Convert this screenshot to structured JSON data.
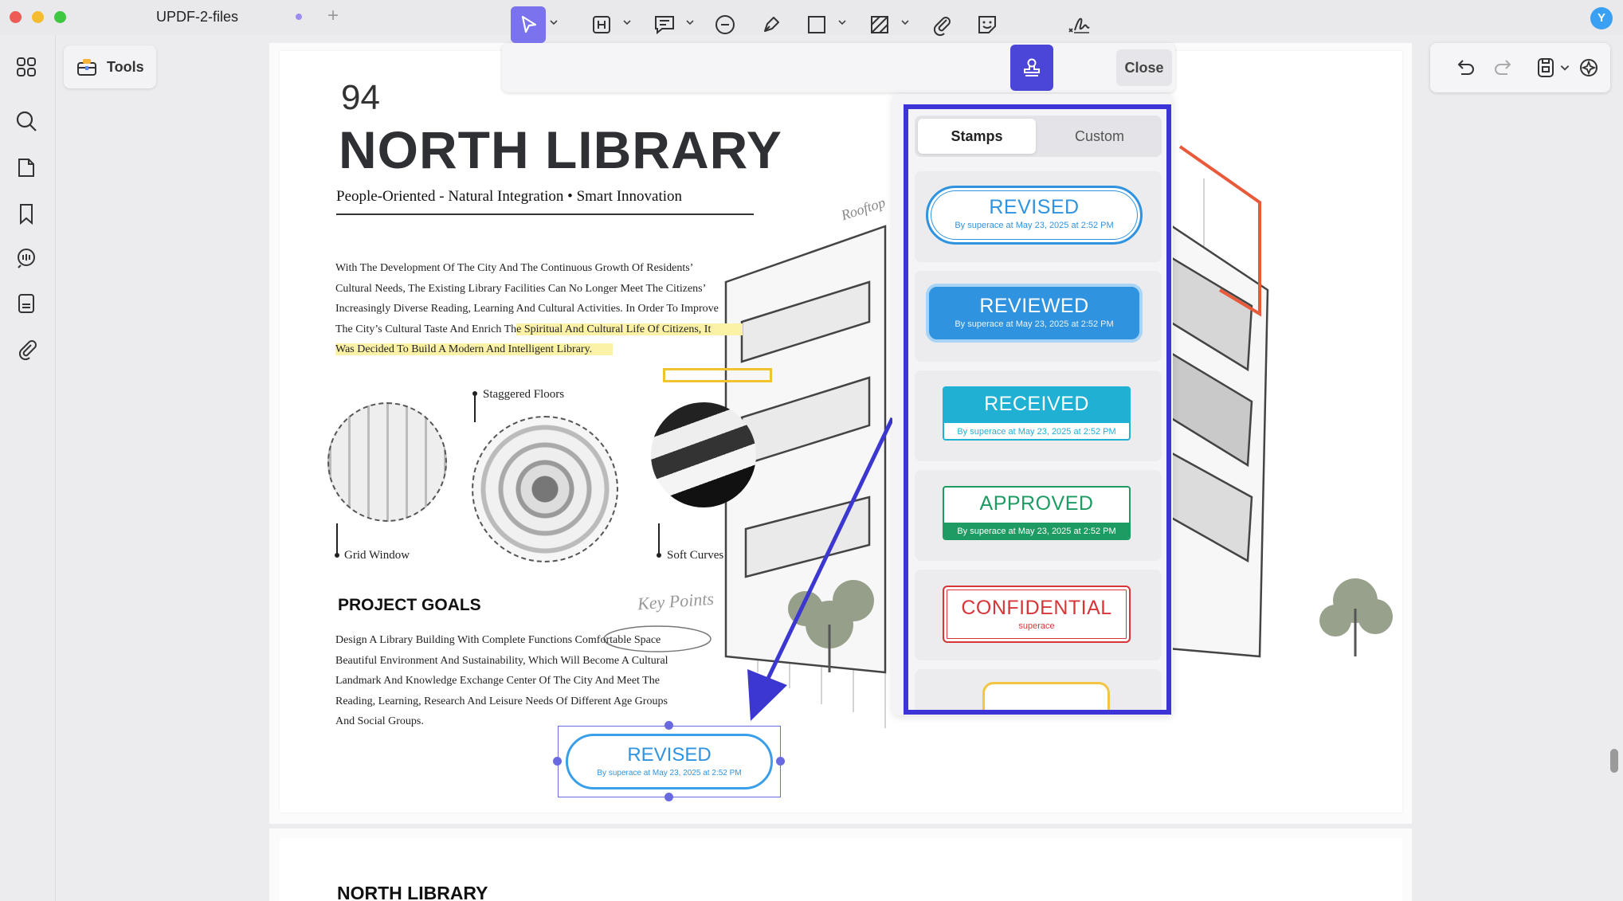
{
  "window": {
    "tab_title": "UPDF-2-files",
    "user_initial": "Y",
    "traffic_light_colors": [
      "#ee5b56",
      "#f5bc2f",
      "#3ec842"
    ]
  },
  "sidebar": {
    "items": [
      {
        "icon": "grid-apps-icon"
      },
      {
        "icon": "search-icon"
      },
      {
        "icon": "page-icon"
      },
      {
        "icon": "bookmark-icon"
      },
      {
        "icon": "comment-icon"
      },
      {
        "icon": "document-list-icon"
      },
      {
        "icon": "attachment-icon"
      }
    ]
  },
  "tools_button": {
    "label": "Tools",
    "icon": "toolbox-icon"
  },
  "toolbar": {
    "tools": [
      {
        "icon": "select-cursor-icon",
        "active": true
      },
      {
        "icon": "text-box-icon"
      },
      {
        "icon": "text-callout-icon"
      },
      {
        "icon": "comment-bubble-icon"
      },
      {
        "icon": "pen-icon"
      },
      {
        "icon": "rectangle-icon"
      },
      {
        "icon": "hatch-area-icon"
      },
      {
        "icon": "paperclip-icon"
      },
      {
        "icon": "sticker-icon"
      },
      {
        "icon": "stamp-icon",
        "active": true
      },
      {
        "icon": "signature-icon"
      }
    ],
    "close_label": "Close",
    "accent_color": "#4b45d8"
  },
  "right_toolbar": {
    "tools": [
      {
        "icon": "undo-icon"
      },
      {
        "icon": "redo-icon"
      },
      {
        "icon": "save-icon"
      },
      {
        "icon": "ai-assistant-icon"
      }
    ]
  },
  "document": {
    "page_number": "94",
    "title": "NORTH LIBRARY",
    "subtitle": "People-Oriented - Natural Integration • Smart Innovation",
    "intro_lines": [
      "With The Development Of The City And The Continuous Growth Of Residents’",
      "Cultural Needs, The Existing Library Facilities Can No Longer Meet The Citizens’",
      "Increasingly Diverse Reading, Learning And Cultural Activities. In Order To Improve",
      "The City’s Cultural Taste And Enrich Th",
      "e Spiritual And Cultural Life Of Citizens, It",
      "Was Decided To Build A Modern And Intelligent Library."
    ],
    "captions": {
      "staggered_floors": "Staggered Floors",
      "grid_window": "Grid Window",
      "soft_curves": "Soft Curves"
    },
    "rooftop_label": "Rooftop",
    "goals_title": "PROJECT GOALS",
    "key_points": "Key Points",
    "goals_lines": [
      "Design A Library Building With Complete Functions Comfortable Space",
      "Beautiful Environment And Sustainability, Which Will Become A Cultural",
      "Landmark And Knowledge Exchange Center Of The City And Meet The",
      "Reading, Learning, Research And Leisure Needs Of Different Age Groups",
      "And Social Groups."
    ],
    "next_page_title": "NORTH LIBRARY",
    "placed_stamp": {
      "label": "REVISED",
      "meta": "By superace at May 23, 2025 at 2:52 PM"
    }
  },
  "stamps_panel": {
    "tabs": [
      {
        "label": "Stamps",
        "selected": true
      },
      {
        "label": "Custom",
        "selected": false
      }
    ],
    "stamps": [
      {
        "label": "REVISED",
        "meta": "By superace at May 23, 2025 at 2:52 PM",
        "color": "#2f93e0"
      },
      {
        "label": "REVIEWED",
        "meta": "By superace at May 23, 2025 at 2:52 PM",
        "color": "#2f93e0"
      },
      {
        "label": "RECEIVED",
        "meta": "By superace at May 23, 2025 at 2:52 PM",
        "color": "#1fb0d4"
      },
      {
        "label": "APPROVED",
        "meta": "By superace at May 23, 2025 at 2:52 PM",
        "color": "#1e9b62"
      },
      {
        "label": "CONFIDENTIAL",
        "meta": "superace",
        "color": "#d8353a"
      }
    ],
    "highlight_color": "#3c34d6"
  }
}
